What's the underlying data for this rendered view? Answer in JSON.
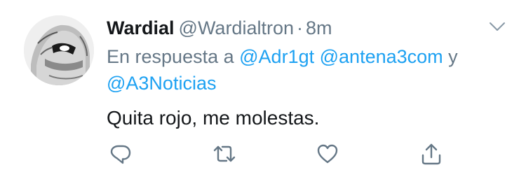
{
  "tweet": {
    "display_name": "Wardial",
    "handle": "@Wardialtron",
    "separator": "·",
    "time": "8m",
    "reply_prefix": "En respuesta a",
    "mentions": [
      "@Adr1gt",
      "@antena3com",
      "@A3Noticias"
    ],
    "mention_joiner": "y",
    "text": "Quita rojo, me molestas."
  },
  "actions": {
    "reply_icon": "reply-icon",
    "retweet_icon": "retweet-icon",
    "like_icon": "heart-icon",
    "share_icon": "share-icon"
  },
  "colors": {
    "link": "#1da1f2",
    "secondary_text": "#657786",
    "primary_text": "#14171a"
  }
}
